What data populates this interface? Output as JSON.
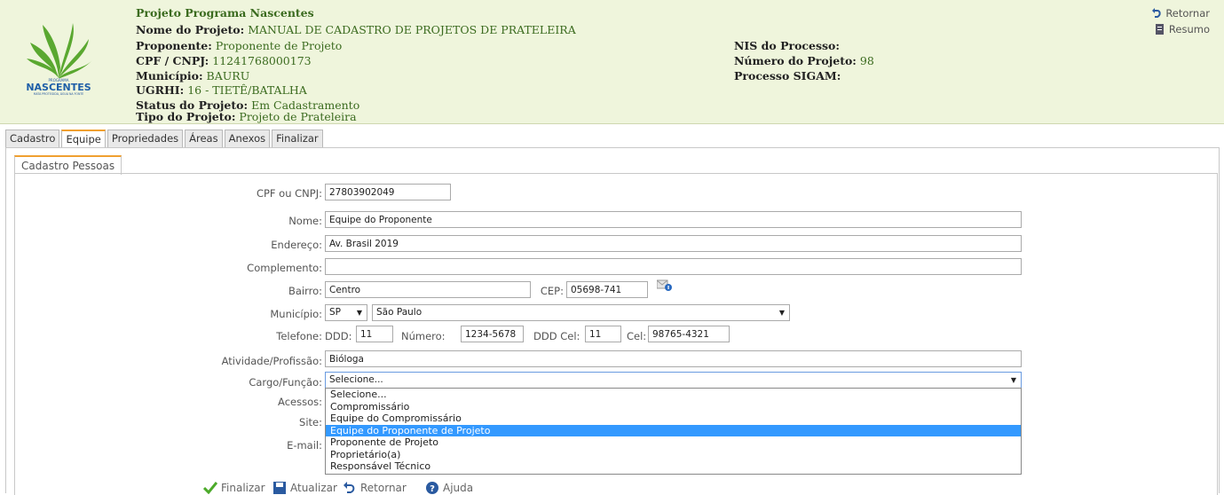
{
  "header": {
    "program_title": "Projeto Programa Nascentes",
    "lines": [
      {
        "label": "Nome do Projeto:",
        "value": " MANUAL DE CADASTRO DE PROJETOS DE PRATELEIRA"
      },
      {
        "label": "Proponente:",
        "value": " Proponente de Projeto"
      },
      {
        "label": "CPF / CNPJ:",
        "value": " 11241768000173"
      },
      {
        "label": "Município:",
        "value": " BAURU"
      },
      {
        "label": "UGRHI:",
        "value": " 16 - TIETÊ/BATALHA"
      },
      {
        "label": "Status do Projeto:",
        "value": " Em Cadastramento"
      },
      {
        "label": "Tipo do Projeto:",
        "value": " Projeto de Prateleira"
      }
    ],
    "right_lines": [
      {
        "label": "NIS do Processo:",
        "value": ""
      },
      {
        "label": "Número do Projeto:",
        "value": " 98"
      },
      {
        "label": "Processo SIGAM:",
        "value": ""
      }
    ],
    "logo_text": "NASCENTES",
    "logo_small_top": "PROGRAMA",
    "logo_small_bottom": "MATA PROTEGIDA, ÁGUA NA FONTE",
    "retornar": "Retornar",
    "resumo": "Resumo"
  },
  "tabs": [
    "Cadastro",
    "Equipe",
    "Propriedades",
    "Áreas",
    "Anexos",
    "Finalizar"
  ],
  "subtab": "Cadastro Pessoas",
  "form": {
    "cpf_label": "CPF ou CNPJ:",
    "cpf_value": "27803902049",
    "nome_label": "Nome:",
    "nome_value": "Equipe do Proponente",
    "endereco_label": "Endereço:",
    "endereco_value": "Av. Brasil 2019",
    "complemento_label": "Complemento:",
    "complemento_value": "",
    "bairro_label": "Bairro:",
    "bairro_value": "Centro",
    "cep_label": "CEP:",
    "cep_value": "05698-741",
    "municipio_label": "Município:",
    "uf_value": "SP",
    "municipio_value": "São Paulo",
    "telefone_label": "Telefone:",
    "ddd_label": "DDD:",
    "ddd_value": "11",
    "numero_label": "Número:",
    "numero_value": "1234-5678",
    "dddcel_label": "DDD Cel:",
    "dddcel_value": "11",
    "cel_label": "Cel:",
    "cel_value": "98765-4321",
    "atividade_label": "Atividade/Profissão:",
    "atividade_value": "Bióloga",
    "cargo_label": "Cargo/Função:",
    "cargo_value": "Selecione...",
    "acessos_label": "Acessos:",
    "site_label": "Site:",
    "email_label": "E-mail:"
  },
  "cargo_options": [
    "Selecione...",
    "Compromissário",
    "Equipe do Compromissário",
    "Equipe do Proponente de Projeto",
    "Proponente de Projeto",
    "Proprietário(a)",
    "Responsável Técnico"
  ],
  "buttons": {
    "finalizar": "Finalizar",
    "atualizar": "Atualizar",
    "retornar": "Retornar",
    "ajuda": "Ajuda"
  }
}
